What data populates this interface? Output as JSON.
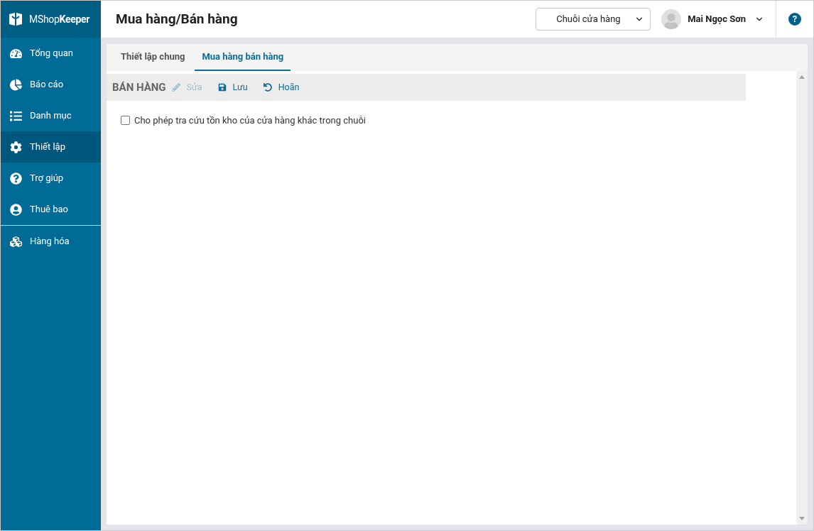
{
  "sidebar": {
    "logo": {
      "prefix": "MShop",
      "suffix": "Keeper"
    },
    "groups": [
      {
        "items": [
          {
            "kind": "gauge",
            "label": "Tổng quan",
            "selected": false
          },
          {
            "kind": "pie",
            "label": "Báo cáo",
            "selected": false
          },
          {
            "kind": "list",
            "label": "Danh mục",
            "selected": false
          },
          {
            "kind": "gear",
            "label": "Thiết lập",
            "selected": true
          },
          {
            "kind": "help",
            "label": "Trợ giúp",
            "selected": false
          },
          {
            "kind": "user",
            "label": "Thuê bao",
            "selected": false
          }
        ]
      },
      {
        "items": [
          {
            "kind": "cubes",
            "label": "Hàng hóa",
            "selected": false
          }
        ]
      }
    ]
  },
  "header": {
    "title": "Mua hàng/Bán hàng",
    "store_select": {
      "value": "Chuỗi cửa hàng"
    },
    "user": {
      "name": "Mai Ngọc Sơn"
    },
    "help": "?"
  },
  "tabs": [
    {
      "label": "Thiết lập chung",
      "selected": false
    },
    {
      "label": "Mua hàng bán hàng",
      "selected": true
    }
  ],
  "section": {
    "title": "BÁN HÀNG",
    "actions": [
      {
        "kind": "edit",
        "label": "Sửa",
        "disabled": true
      },
      {
        "kind": "save",
        "label": "Lưu",
        "disabled": false
      },
      {
        "kind": "undo",
        "label": "Hoãn",
        "disabled": false
      }
    ],
    "options": [
      {
        "label": "Cho phép tra cứu tồn kho của cửa hàng khác trong chuỗi",
        "checked": false
      }
    ]
  }
}
